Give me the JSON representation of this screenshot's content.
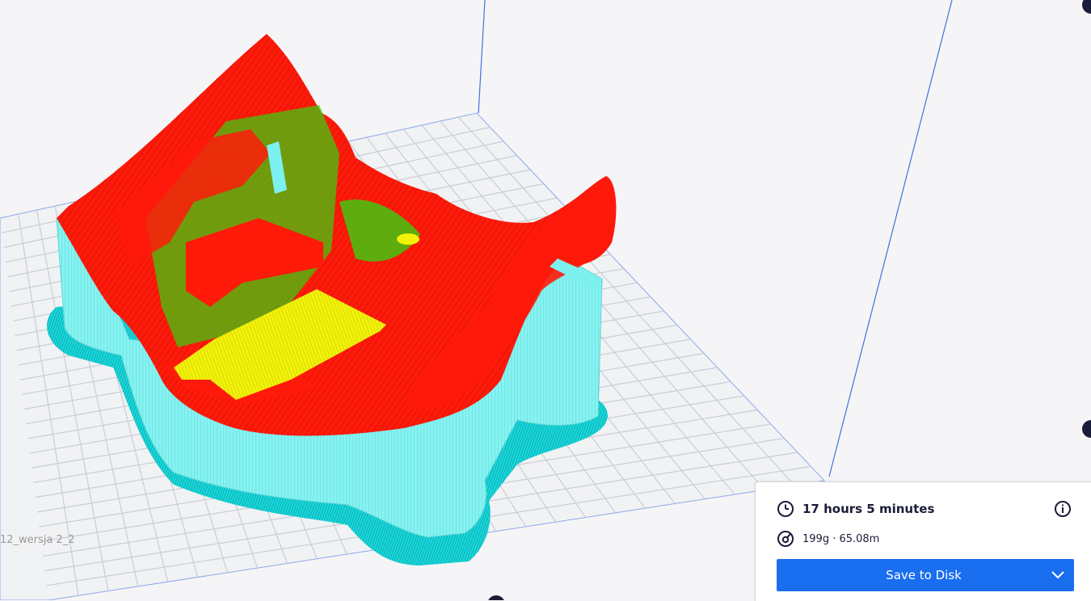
{
  "scene": {
    "model_name": "12_wersja 2_2",
    "colors": {
      "background": "#f5f5f7",
      "grid_line": "#c9cdd3",
      "grid_fill": "#f1f2f4",
      "build_volume_edge": "#3d73e0",
      "wall_red": "#ff1a0a",
      "infill_yellow": "#f2f20a",
      "skin_green": "#43c70f",
      "support_cyan": "#7cf0ef",
      "skirt_cyan": "#18d7dd"
    }
  },
  "print_info": {
    "time_icon": "clock-icon",
    "time": "17 hours 5 minutes",
    "material_icon": "spool-icon",
    "material": "199g · 65.08m",
    "info_icon": "info-icon"
  },
  "save": {
    "label": "Save to Disk",
    "dropdown_icon": "chevron-down-icon",
    "color": "#196ef0"
  }
}
